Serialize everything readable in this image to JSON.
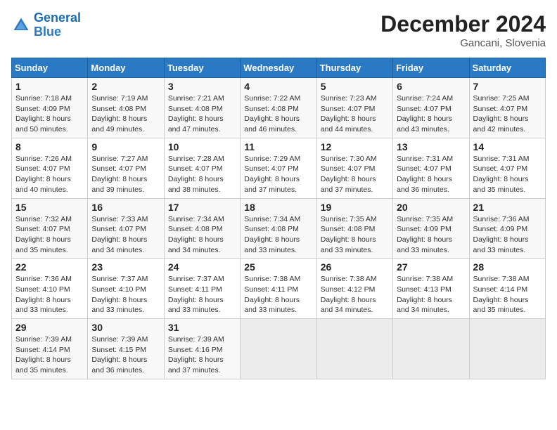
{
  "header": {
    "logo_line1": "General",
    "logo_line2": "Blue",
    "month": "December 2024",
    "location": "Gancani, Slovenia"
  },
  "weekdays": [
    "Sunday",
    "Monday",
    "Tuesday",
    "Wednesday",
    "Thursday",
    "Friday",
    "Saturday"
  ],
  "weeks": [
    [
      {
        "day": "1",
        "sunrise": "Sunrise: 7:18 AM",
        "sunset": "Sunset: 4:09 PM",
        "daylight": "Daylight: 8 hours and 50 minutes."
      },
      {
        "day": "2",
        "sunrise": "Sunrise: 7:19 AM",
        "sunset": "Sunset: 4:08 PM",
        "daylight": "Daylight: 8 hours and 49 minutes."
      },
      {
        "day": "3",
        "sunrise": "Sunrise: 7:21 AM",
        "sunset": "Sunset: 4:08 PM",
        "daylight": "Daylight: 8 hours and 47 minutes."
      },
      {
        "day": "4",
        "sunrise": "Sunrise: 7:22 AM",
        "sunset": "Sunset: 4:08 PM",
        "daylight": "Daylight: 8 hours and 46 minutes."
      },
      {
        "day": "5",
        "sunrise": "Sunrise: 7:23 AM",
        "sunset": "Sunset: 4:07 PM",
        "daylight": "Daylight: 8 hours and 44 minutes."
      },
      {
        "day": "6",
        "sunrise": "Sunrise: 7:24 AM",
        "sunset": "Sunset: 4:07 PM",
        "daylight": "Daylight: 8 hours and 43 minutes."
      },
      {
        "day": "7",
        "sunrise": "Sunrise: 7:25 AM",
        "sunset": "Sunset: 4:07 PM",
        "daylight": "Daylight: 8 hours and 42 minutes."
      }
    ],
    [
      {
        "day": "8",
        "sunrise": "Sunrise: 7:26 AM",
        "sunset": "Sunset: 4:07 PM",
        "daylight": "Daylight: 8 hours and 40 minutes."
      },
      {
        "day": "9",
        "sunrise": "Sunrise: 7:27 AM",
        "sunset": "Sunset: 4:07 PM",
        "daylight": "Daylight: 8 hours and 39 minutes."
      },
      {
        "day": "10",
        "sunrise": "Sunrise: 7:28 AM",
        "sunset": "Sunset: 4:07 PM",
        "daylight": "Daylight: 8 hours and 38 minutes."
      },
      {
        "day": "11",
        "sunrise": "Sunrise: 7:29 AM",
        "sunset": "Sunset: 4:07 PM",
        "daylight": "Daylight: 8 hours and 37 minutes."
      },
      {
        "day": "12",
        "sunrise": "Sunrise: 7:30 AM",
        "sunset": "Sunset: 4:07 PM",
        "daylight": "Daylight: 8 hours and 37 minutes."
      },
      {
        "day": "13",
        "sunrise": "Sunrise: 7:31 AM",
        "sunset": "Sunset: 4:07 PM",
        "daylight": "Daylight: 8 hours and 36 minutes."
      },
      {
        "day": "14",
        "sunrise": "Sunrise: 7:31 AM",
        "sunset": "Sunset: 4:07 PM",
        "daylight": "Daylight: 8 hours and 35 minutes."
      }
    ],
    [
      {
        "day": "15",
        "sunrise": "Sunrise: 7:32 AM",
        "sunset": "Sunset: 4:07 PM",
        "daylight": "Daylight: 8 hours and 35 minutes."
      },
      {
        "day": "16",
        "sunrise": "Sunrise: 7:33 AM",
        "sunset": "Sunset: 4:07 PM",
        "daylight": "Daylight: 8 hours and 34 minutes."
      },
      {
        "day": "17",
        "sunrise": "Sunrise: 7:34 AM",
        "sunset": "Sunset: 4:08 PM",
        "daylight": "Daylight: 8 hours and 34 minutes."
      },
      {
        "day": "18",
        "sunrise": "Sunrise: 7:34 AM",
        "sunset": "Sunset: 4:08 PM",
        "daylight": "Daylight: 8 hours and 33 minutes."
      },
      {
        "day": "19",
        "sunrise": "Sunrise: 7:35 AM",
        "sunset": "Sunset: 4:08 PM",
        "daylight": "Daylight: 8 hours and 33 minutes."
      },
      {
        "day": "20",
        "sunrise": "Sunrise: 7:35 AM",
        "sunset": "Sunset: 4:09 PM",
        "daylight": "Daylight: 8 hours and 33 minutes."
      },
      {
        "day": "21",
        "sunrise": "Sunrise: 7:36 AM",
        "sunset": "Sunset: 4:09 PM",
        "daylight": "Daylight: 8 hours and 33 minutes."
      }
    ],
    [
      {
        "day": "22",
        "sunrise": "Sunrise: 7:36 AM",
        "sunset": "Sunset: 4:10 PM",
        "daylight": "Daylight: 8 hours and 33 minutes."
      },
      {
        "day": "23",
        "sunrise": "Sunrise: 7:37 AM",
        "sunset": "Sunset: 4:10 PM",
        "daylight": "Daylight: 8 hours and 33 minutes."
      },
      {
        "day": "24",
        "sunrise": "Sunrise: 7:37 AM",
        "sunset": "Sunset: 4:11 PM",
        "daylight": "Daylight: 8 hours and 33 minutes."
      },
      {
        "day": "25",
        "sunrise": "Sunrise: 7:38 AM",
        "sunset": "Sunset: 4:11 PM",
        "daylight": "Daylight: 8 hours and 33 minutes."
      },
      {
        "day": "26",
        "sunrise": "Sunrise: 7:38 AM",
        "sunset": "Sunset: 4:12 PM",
        "daylight": "Daylight: 8 hours and 34 minutes."
      },
      {
        "day": "27",
        "sunrise": "Sunrise: 7:38 AM",
        "sunset": "Sunset: 4:13 PM",
        "daylight": "Daylight: 8 hours and 34 minutes."
      },
      {
        "day": "28",
        "sunrise": "Sunrise: 7:38 AM",
        "sunset": "Sunset: 4:14 PM",
        "daylight": "Daylight: 8 hours and 35 minutes."
      }
    ],
    [
      {
        "day": "29",
        "sunrise": "Sunrise: 7:39 AM",
        "sunset": "Sunset: 4:14 PM",
        "daylight": "Daylight: 8 hours and 35 minutes."
      },
      {
        "day": "30",
        "sunrise": "Sunrise: 7:39 AM",
        "sunset": "Sunset: 4:15 PM",
        "daylight": "Daylight: 8 hours and 36 minutes."
      },
      {
        "day": "31",
        "sunrise": "Sunrise: 7:39 AM",
        "sunset": "Sunset: 4:16 PM",
        "daylight": "Daylight: 8 hours and 37 minutes."
      },
      null,
      null,
      null,
      null
    ]
  ]
}
